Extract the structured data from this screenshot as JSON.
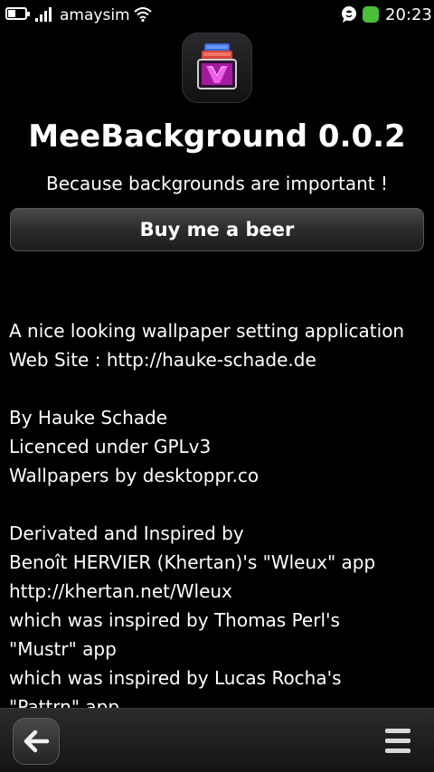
{
  "status_bar": {
    "carrier": "amaysim",
    "time": "20:23",
    "icons": [
      "battery-icon",
      "signal-icon",
      "wifi-icon",
      "message-icon",
      "presence-icon"
    ],
    "presence_color": "#4cbf3a"
  },
  "app": {
    "icon": "meebackground-app-icon",
    "title": "MeeBackground 0.0.2",
    "tagline": "Because backgrounds are important !",
    "buy_button_label": "Buy me a beer"
  },
  "about": {
    "lines": [
      "A nice looking wallpaper setting application",
      "Web Site : http://hauke-schade.de",
      "",
      "By Hauke Schade",
      "Licenced under GPLv3",
      "Wallpapers by desktoppr.co",
      "",
      "Derivated and Inspired by",
      "Benoît HERVIER (Khertan)'s \"Wleux\" app",
      "http://khertan.net/Wleux",
      "which was inspired by Thomas Perl's",
      "\"Mustr\" app",
      "which was inspired by Lucas Rocha's",
      "\"Pattrn\" app"
    ]
  },
  "toolbar": {
    "back_icon": "back-arrow-icon",
    "menu_icon": "menu-icon"
  }
}
